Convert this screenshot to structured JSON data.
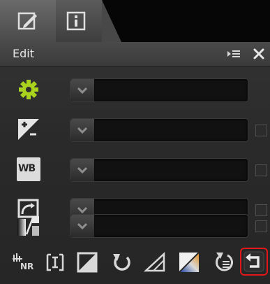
{
  "tabs": [
    {
      "name": "edit",
      "icon": "pencil-icon"
    },
    {
      "name": "info",
      "icon": "info-icon"
    }
  ],
  "panel": {
    "title": "Edit",
    "header_buttons": [
      "list-menu-icon",
      "close-icon"
    ]
  },
  "tools": [
    {
      "icon": "gear-icon",
      "has_checkbox": false
    },
    {
      "icon": "exposure-compensation-icon",
      "has_checkbox": true
    },
    {
      "icon": "white-balance-icon",
      "has_checkbox": true
    },
    {
      "icon": "picture-control-icon",
      "has_checkbox": true
    },
    {
      "icon": "levels-curves-icon",
      "has_checkbox": true
    }
  ],
  "toolbar": {
    "icons": [
      "noise-reduction-icon",
      "straighten-icon",
      "crop-icon",
      "rotate-icon",
      "perspective-icon",
      "color-curve-icon",
      "step-history-icon",
      "reset-icon"
    ],
    "wb_label": "WB",
    "nr_label": "NR"
  },
  "colors": {
    "accent_green": "#a8d21e",
    "highlight_red": "#e21818"
  }
}
